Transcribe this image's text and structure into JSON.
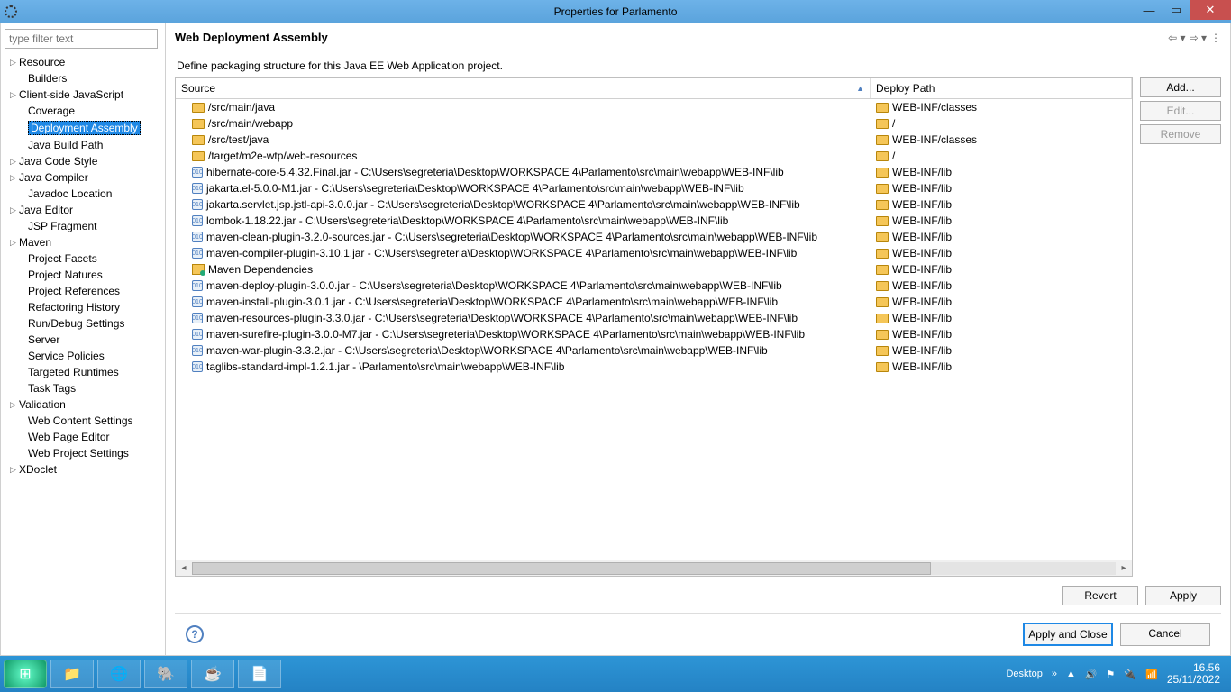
{
  "window": {
    "title": "Properties for Parlamento"
  },
  "sidebar": {
    "filterPlaceholder": "type filter text",
    "items": [
      {
        "label": "Resource",
        "expandable": true,
        "indent": false
      },
      {
        "label": "Builders",
        "expandable": false,
        "indent": true
      },
      {
        "label": "Client-side JavaScript",
        "expandable": true,
        "indent": false
      },
      {
        "label": "Coverage",
        "expandable": false,
        "indent": true
      },
      {
        "label": "Deployment Assembly",
        "expandable": false,
        "indent": true,
        "selected": true
      },
      {
        "label": "Java Build Path",
        "expandable": false,
        "indent": true
      },
      {
        "label": "Java Code Style",
        "expandable": true,
        "indent": false
      },
      {
        "label": "Java Compiler",
        "expandable": true,
        "indent": false
      },
      {
        "label": "Javadoc Location",
        "expandable": false,
        "indent": true
      },
      {
        "label": "Java Editor",
        "expandable": true,
        "indent": false
      },
      {
        "label": "JSP Fragment",
        "expandable": false,
        "indent": true
      },
      {
        "label": "Maven",
        "expandable": true,
        "indent": false
      },
      {
        "label": "Project Facets",
        "expandable": false,
        "indent": true
      },
      {
        "label": "Project Natures",
        "expandable": false,
        "indent": true
      },
      {
        "label": "Project References",
        "expandable": false,
        "indent": true
      },
      {
        "label": "Refactoring History",
        "expandable": false,
        "indent": true
      },
      {
        "label": "Run/Debug Settings",
        "expandable": false,
        "indent": true
      },
      {
        "label": "Server",
        "expandable": false,
        "indent": true
      },
      {
        "label": "Service Policies",
        "expandable": false,
        "indent": true
      },
      {
        "label": "Targeted Runtimes",
        "expandable": false,
        "indent": true
      },
      {
        "label": "Task Tags",
        "expandable": false,
        "indent": true
      },
      {
        "label": "Validation",
        "expandable": true,
        "indent": false
      },
      {
        "label": "Web Content Settings",
        "expandable": false,
        "indent": true
      },
      {
        "label": "Web Page Editor",
        "expandable": false,
        "indent": true
      },
      {
        "label": "Web Project Settings",
        "expandable": false,
        "indent": true
      },
      {
        "label": "XDoclet",
        "expandable": true,
        "indent": false
      }
    ]
  },
  "page": {
    "title": "Web Deployment Assembly",
    "description": "Define packaging structure for this Java EE Web Application project.",
    "columns": {
      "source": "Source",
      "deploy": "Deploy Path"
    },
    "rows": [
      {
        "icon": "folder",
        "source": "/src/main/java",
        "deploy": "WEB-INF/classes"
      },
      {
        "icon": "folder",
        "source": "/src/main/webapp",
        "deploy": "/"
      },
      {
        "icon": "folder",
        "source": "/src/test/java",
        "deploy": "WEB-INF/classes"
      },
      {
        "icon": "folder",
        "source": "/target/m2e-wtp/web-resources",
        "deploy": "/"
      },
      {
        "icon": "jar",
        "source": "hibernate-core-5.4.32.Final.jar - C:\\Users\\segreteria\\Desktop\\WORKSPACE 4\\Parlamento\\src\\main\\webapp\\WEB-INF\\lib",
        "deploy": "WEB-INF/lib"
      },
      {
        "icon": "jar",
        "source": "jakarta.el-5.0.0-M1.jar - C:\\Users\\segreteria\\Desktop\\WORKSPACE 4\\Parlamento\\src\\main\\webapp\\WEB-INF\\lib",
        "deploy": "WEB-INF/lib"
      },
      {
        "icon": "jar",
        "source": "jakarta.servlet.jsp.jstl-api-3.0.0.jar - C:\\Users\\segreteria\\Desktop\\WORKSPACE 4\\Parlamento\\src\\main\\webapp\\WEB-INF\\lib",
        "deploy": "WEB-INF/lib"
      },
      {
        "icon": "jar",
        "source": "lombok-1.18.22.jar - C:\\Users\\segreteria\\Desktop\\WORKSPACE 4\\Parlamento\\src\\main\\webapp\\WEB-INF\\lib",
        "deploy": "WEB-INF/lib"
      },
      {
        "icon": "jar",
        "source": "maven-clean-plugin-3.2.0-sources.jar - C:\\Users\\segreteria\\Desktop\\WORKSPACE 4\\Parlamento\\src\\main\\webapp\\WEB-INF\\lib",
        "deploy": "WEB-INF/lib"
      },
      {
        "icon": "jar",
        "source": "maven-compiler-plugin-3.10.1.jar - C:\\Users\\segreteria\\Desktop\\WORKSPACE 4\\Parlamento\\src\\main\\webapp\\WEB-INF\\lib",
        "deploy": "WEB-INF/lib"
      },
      {
        "icon": "lib",
        "source": "Maven Dependencies",
        "deploy": "WEB-INF/lib"
      },
      {
        "icon": "jar",
        "source": "maven-deploy-plugin-3.0.0.jar - C:\\Users\\segreteria\\Desktop\\WORKSPACE 4\\Parlamento\\src\\main\\webapp\\WEB-INF\\lib",
        "deploy": "WEB-INF/lib"
      },
      {
        "icon": "jar",
        "source": "maven-install-plugin-3.0.1.jar - C:\\Users\\segreteria\\Desktop\\WORKSPACE 4\\Parlamento\\src\\main\\webapp\\WEB-INF\\lib",
        "deploy": "WEB-INF/lib"
      },
      {
        "icon": "jar",
        "source": "maven-resources-plugin-3.3.0.jar - C:\\Users\\segreteria\\Desktop\\WORKSPACE 4\\Parlamento\\src\\main\\webapp\\WEB-INF\\lib",
        "deploy": "WEB-INF/lib"
      },
      {
        "icon": "jar",
        "source": "maven-surefire-plugin-3.0.0-M7.jar - C:\\Users\\segreteria\\Desktop\\WORKSPACE 4\\Parlamento\\src\\main\\webapp\\WEB-INF\\lib",
        "deploy": "WEB-INF/lib"
      },
      {
        "icon": "jar",
        "source": "maven-war-plugin-3.3.2.jar - C:\\Users\\segreteria\\Desktop\\WORKSPACE 4\\Parlamento\\src\\main\\webapp\\WEB-INF\\lib",
        "deploy": "WEB-INF/lib"
      },
      {
        "icon": "jar",
        "source": "taglibs-standard-impl-1.2.1.jar - \\Parlamento\\src\\main\\webapp\\WEB-INF\\lib",
        "deploy": "WEB-INF/lib"
      }
    ],
    "emptyRows": 10,
    "buttons": {
      "add": "Add...",
      "edit": "Edit...",
      "remove": "Remove"
    },
    "footerButtons": {
      "revert": "Revert",
      "apply": "Apply"
    }
  },
  "dialog": {
    "applyClose": "Apply and Close",
    "cancel": "Cancel"
  },
  "taskbar": {
    "desktopLabel": "Desktop",
    "time": "16.56",
    "date": "25/11/2022"
  }
}
